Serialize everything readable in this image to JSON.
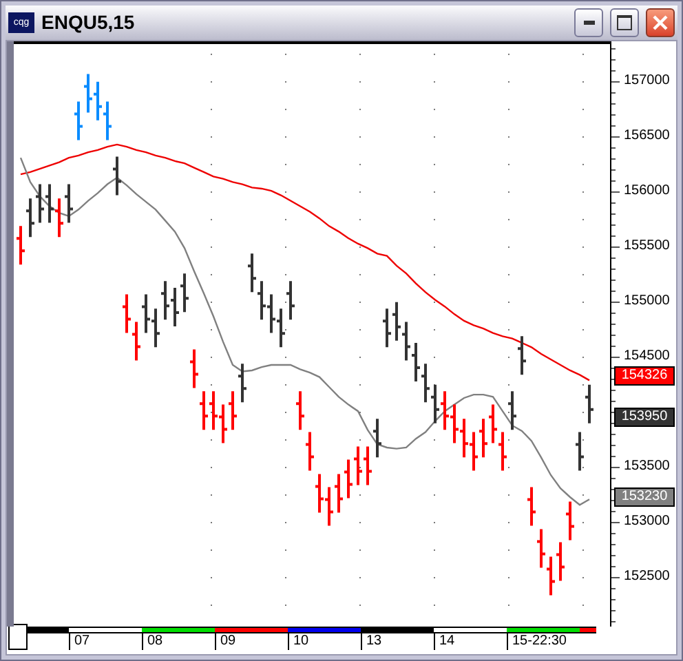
{
  "window": {
    "icon_text": "cqg",
    "title": "ENQU5,15"
  },
  "chart": {
    "chart_data": {
      "type": "line",
      "ylim": [
        152050,
        157362
      ],
      "yticks": [
        {
          "value": 157000,
          "label": "157000"
        },
        {
          "value": 156500,
          "label": "156500"
        },
        {
          "value": 156000,
          "label": "156000"
        },
        {
          "value": 155500,
          "label": "155500"
        },
        {
          "value": 155000,
          "label": "155000"
        },
        {
          "value": 154500,
          "label": "154500"
        },
        {
          "value": 153500,
          "label": "153500"
        },
        {
          "value": 153000,
          "label": "153000"
        },
        {
          "value": 152500,
          "label": "152500"
        }
      ],
      "series": [
        {
          "color": "#ee0000",
          "values": [
            156180,
            156200,
            156230,
            156260,
            156290,
            156330,
            156350,
            156380,
            156400,
            156430,
            156450,
            156430,
            156400,
            156380,
            156350,
            156330,
            156300,
            156280,
            156240,
            156200,
            156160,
            156140,
            156110,
            156090,
            156060,
            156050,
            156030,
            155990,
            155940,
            155890,
            155840,
            155780,
            155710,
            155660,
            155600,
            155550,
            155510,
            155460,
            155440,
            155350,
            155280,
            155190,
            155110,
            155040,
            154980,
            154910,
            154850,
            154810,
            154780,
            154740,
            154710,
            154690,
            154650,
            154610,
            154550,
            154500,
            154450,
            154400,
            154360,
            154310
          ]
        },
        {
          "color": "#808080",
          "values": [
            156330,
            156110,
            155980,
            155890,
            155830,
            155800,
            155860,
            155940,
            156010,
            156090,
            156150,
            156080,
            156000,
            155930,
            155860,
            155760,
            155660,
            155510,
            155300,
            155100,
            154890,
            154660,
            154450,
            154390,
            154400,
            154430,
            154450,
            154450,
            154450,
            154410,
            154380,
            154340,
            154250,
            154160,
            154090,
            154030,
            153860,
            153730,
            153700,
            153690,
            153700,
            153780,
            153840,
            153940,
            154030,
            154090,
            154150,
            154180,
            154180,
            154160,
            154030,
            153900,
            153850,
            153760,
            153610,
            153450,
            153330,
            153250,
            153180,
            153230
          ]
        }
      ]
    },
    "price_badges": [
      {
        "text": "154326",
        "color": "#ff0000"
      },
      {
        "text": "153950",
        "color": "#333333"
      },
      {
        "text": "153230",
        "color": "#808080"
      }
    ],
    "time_axis": [
      {
        "color": "#000000"
      },
      {
        "label": "07",
        "color": "#ffffff"
      },
      {
        "label": "08",
        "color": "#00dd00"
      },
      {
        "label": "09",
        "color": "#ff0000"
      },
      {
        "label": "10",
        "color": "#0000ee"
      },
      {
        "label": "13",
        "color": "#000000"
      },
      {
        "label": "14",
        "color": "#ffffff"
      },
      {
        "label": "15-22:30",
        "color": "#00dd00"
      },
      {
        "color": "#ff0000"
      }
    ]
  }
}
